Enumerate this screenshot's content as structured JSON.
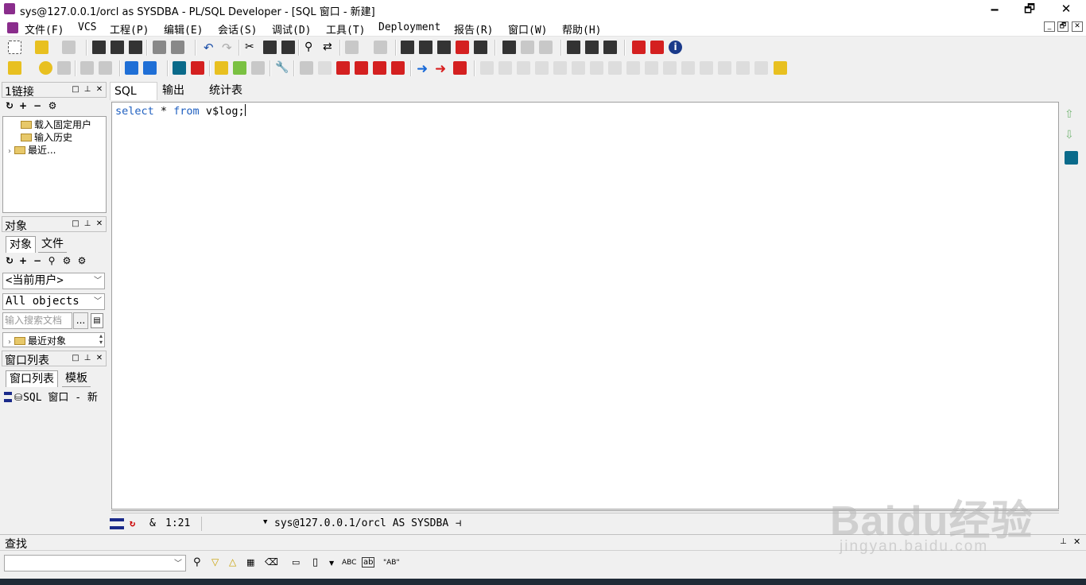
{
  "window": {
    "title": "sys@127.0.0.1/orcl as SYSDBA - PL/SQL Developer - [SQL 窗口 - 新建]",
    "minimize": "🗕",
    "maximize": "🗗",
    "close": "✕"
  },
  "menu": [
    "文件(F)",
    "VCS",
    "工程(P)",
    "编辑(E)",
    "会话(S)",
    "调试(D)",
    "工具(T)",
    "Deployment",
    "报告(R)",
    "窗口(W)",
    "帮助(H)"
  ],
  "mdi_buttons": [
    "_",
    "🗗",
    "✕"
  ],
  "connections_panel": {
    "title": "1链接",
    "tree": [
      "载入固定用户",
      "输入历史",
      "最近..."
    ]
  },
  "objects_panel": {
    "title": "对象",
    "tabs": [
      "对象",
      "文件"
    ],
    "owner_select": "<当前用户>",
    "type_select": "All objects",
    "search_placeholder": "输入搜索文档",
    "search_button": "...",
    "recent_item": "最近对象"
  },
  "windows_panel": {
    "title": "窗口列表",
    "tabs": [
      "窗口列表",
      "模板"
    ],
    "item": "SQL 窗口 - 新"
  },
  "editor": {
    "tabs": [
      "SQL",
      "输出",
      "统计表"
    ],
    "sql_kw1": "select",
    "sql_mid": " * ",
    "sql_kw2": "from",
    "sql_tail": " v$log;"
  },
  "status": {
    "ampersand": "&",
    "position": "1:21",
    "connection": "sys@127.0.0.1/orcl AS SYSDBA"
  },
  "find_panel": {
    "title": "查找",
    "options": [
      "ABC",
      "ab",
      "\"AB\""
    ]
  },
  "watermark": {
    "brand": "Baidu经验",
    "url": "jingyan.baidu.com"
  }
}
